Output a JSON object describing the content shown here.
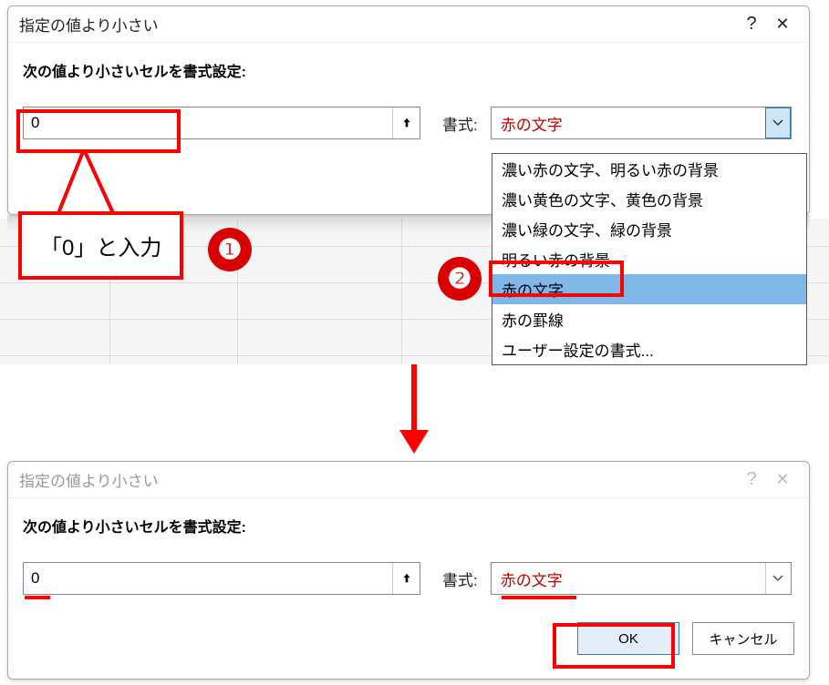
{
  "dialog1": {
    "title": "指定の値より小さい",
    "help": "?",
    "close": "✕",
    "prompt": "次の値より小さいセルを書式設定:",
    "value": "0",
    "format_label": "書式:",
    "format_selected": "赤の文字"
  },
  "dropdown": {
    "options": [
      "濃い赤の文字、明るい赤の背景",
      "濃い黄色の文字、黄色の背景",
      "濃い緑の文字、緑の背景",
      "明るい赤の背景",
      "赤の文字",
      "赤の罫線",
      "ユーザー設定の書式..."
    ]
  },
  "callout_text": "「0」と入力",
  "badge1": "❶",
  "badge2": "❷",
  "dialog2": {
    "title": "指定の値より小さい",
    "help": "?",
    "close": "✕",
    "prompt": "次の値より小さいセルを書式設定:",
    "value": "0",
    "format_label": "書式:",
    "format_selected": "赤の文字",
    "ok_label": "OK",
    "cancel_label": "キャンセル"
  }
}
